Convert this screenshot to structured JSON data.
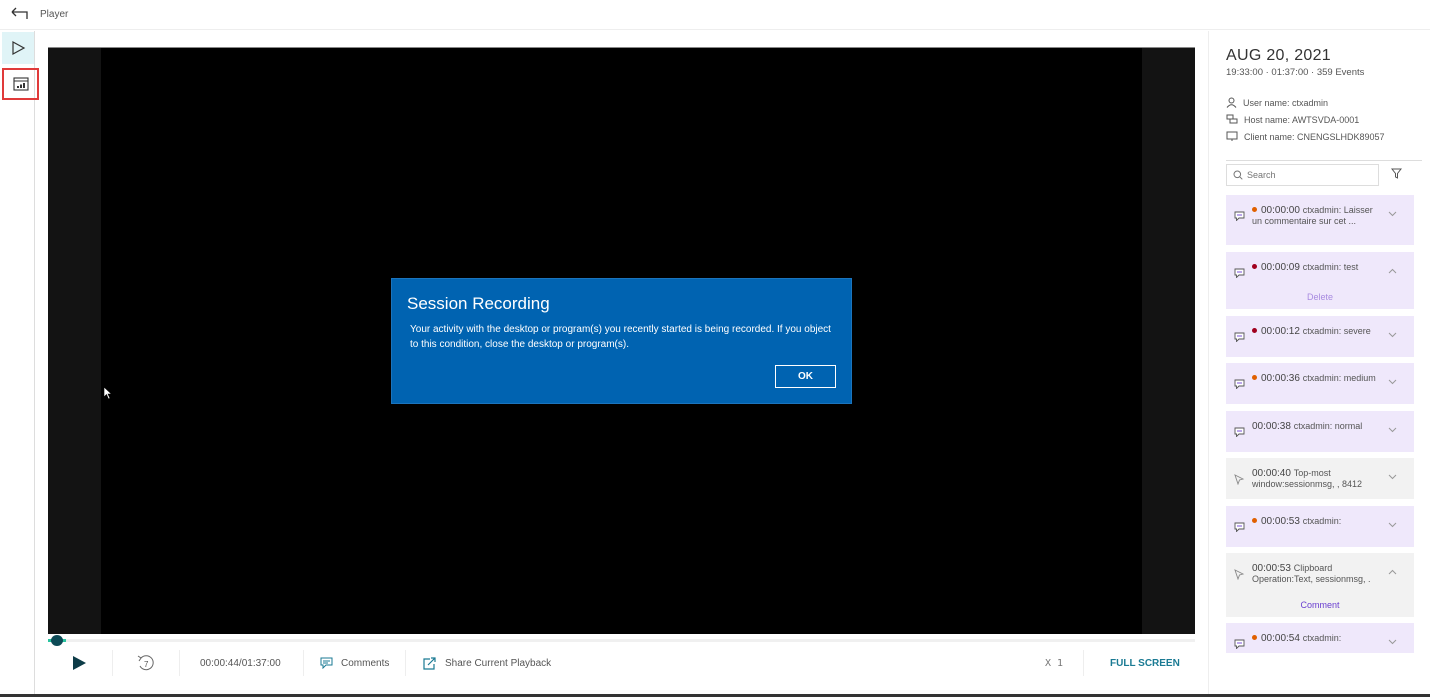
{
  "topbar": {
    "title": "Player",
    "back_icon": "back-arrow-icon"
  },
  "leftrail": {
    "items": [
      {
        "name": "player",
        "icon": "play-outline-icon",
        "active": true
      },
      {
        "name": "statistics",
        "icon": "dashboard-chart-icon",
        "highlighted": true
      }
    ]
  },
  "video": {
    "dialog": {
      "title": "Session Recording",
      "body": "Your activity with the desktop or program(s) you recently started is being recorded. If you object to this condition, close the desktop or program(s).",
      "ok_label": "OK"
    }
  },
  "playback": {
    "progress_fraction": 0.0076,
    "play_icon": "play-icon",
    "rewind_icon": "rewind-7-icon",
    "current_time": "00:00:44",
    "total_time": "01:37:00",
    "time_readout": "00:00:44/01:37:00",
    "comments_label": "Comments",
    "share_label": "Share Current Playback",
    "speed_label": "X 1",
    "fullscreen_label": "FULL SCREEN",
    "accent_color": "#0d4a56",
    "progress_color": "#29c4a0"
  },
  "panel": {
    "date": "AUG 20, 2021",
    "subinfo": "19:33:00 · 01:37:00 · 359 Events",
    "user_name": "User name: ctxadmin",
    "host_name": "Host name: AWTSVDA-0001",
    "client_name": "Client name: CNENGSLHDK89057",
    "search_placeholder": "Search",
    "events": [
      {
        "type": "comment",
        "severity": "medium",
        "time": "00:00:00",
        "text": "ctxadmin: Laisser un commentaire sur cet ...",
        "expanded": false
      },
      {
        "type": "comment",
        "severity": "severe",
        "time": "00:00:09",
        "text": "ctxadmin: test",
        "expanded": true,
        "action": "Delete"
      },
      {
        "type": "comment",
        "severity": "severe",
        "time": "00:00:12",
        "text": "ctxadmin: severe",
        "expanded": false
      },
      {
        "type": "comment",
        "severity": "medium",
        "time": "00:00:36",
        "text": "ctxadmin: medium",
        "expanded": false
      },
      {
        "type": "comment",
        "severity": "normal",
        "time": "00:00:38",
        "text": "ctxadmin: normal",
        "expanded": false
      },
      {
        "type": "operation",
        "severity": "none",
        "time": "00:00:40",
        "text": "Top-most window:sessionmsg, , 8412",
        "expanded": false
      },
      {
        "type": "comment",
        "severity": "medium",
        "time": "00:00:53",
        "text": "ctxadmin:",
        "expanded": false
      },
      {
        "type": "operation",
        "severity": "none",
        "time": "00:00:53",
        "text": "Clipboard Operation:Text, sessionmsg, .",
        "expanded": true,
        "action": "Comment"
      },
      {
        "type": "comment",
        "severity": "medium",
        "time": "00:00:54",
        "text": "ctxadmin:",
        "expanded": false
      }
    ],
    "severity_colors": {
      "severe": "#a0001e",
      "medium": "#e06000",
      "normal": "transparent"
    },
    "action_colors": {
      "Delete": "#a88be0",
      "Comment": "#6a3fd0"
    }
  }
}
